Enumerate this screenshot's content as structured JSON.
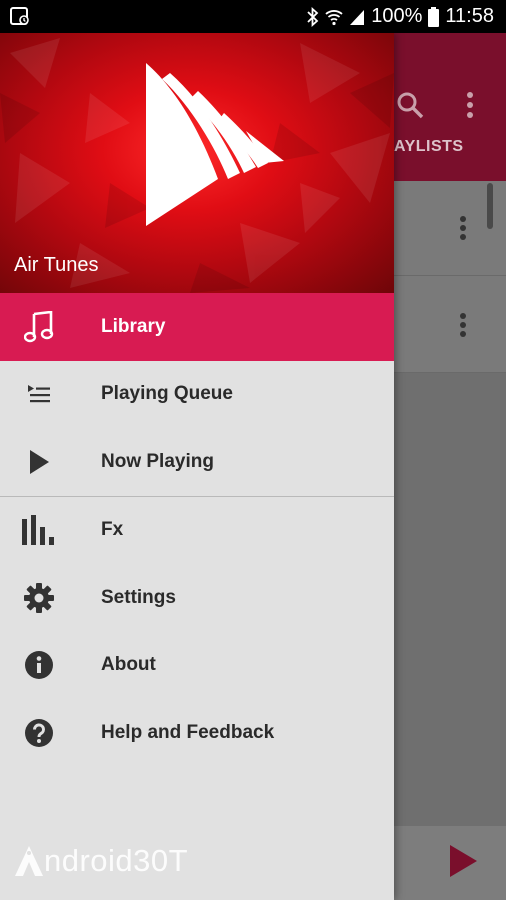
{
  "status_bar": {
    "battery_text": "100%",
    "time": "11:58",
    "icons": [
      "screenshot-icon",
      "bluetooth-icon",
      "wifi-icon",
      "signal-icon",
      "battery-icon"
    ]
  },
  "background_app": {
    "tab_label": "AYLISTS",
    "toolbar_icons": [
      "search-icon",
      "more-vert-icon"
    ],
    "accent_color": "#7a0f2c"
  },
  "drawer": {
    "app_name": "Air Tunes",
    "items": [
      {
        "label": "Library",
        "icon": "music-note-icon",
        "active": true
      },
      {
        "label": "Playing Queue",
        "icon": "queue-icon",
        "active": false
      },
      {
        "label": "Now Playing",
        "icon": "play-icon",
        "active": false
      },
      {
        "label": "Fx",
        "icon": "equalizer-icon",
        "active": false
      },
      {
        "label": "Settings",
        "icon": "gear-icon",
        "active": false
      },
      {
        "label": "About",
        "icon": "info-icon",
        "active": false
      },
      {
        "label": "Help and Feedback",
        "icon": "help-icon",
        "active": false
      }
    ],
    "active_color": "#d81b52"
  },
  "watermark": {
    "text": "ndroid30T"
  }
}
